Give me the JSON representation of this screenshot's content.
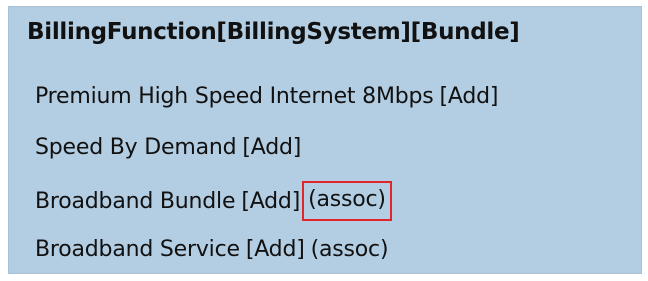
{
  "header": {
    "title": "BillingFunction[BillingSystem][Bundle]"
  },
  "items": [
    {
      "name": "Premium High Speed Internet 8Mbps",
      "action": "[Add]",
      "assoc": null
    },
    {
      "name": "Speed By Demand",
      "action": "[Add]",
      "assoc": null
    },
    {
      "name": "Broadband Bundle",
      "action": "[Add]",
      "assoc": "(assoc)",
      "highlighted": true
    },
    {
      "name": "Broadband Service",
      "action": "[Add]",
      "assoc": "(assoc)"
    }
  ],
  "colors": {
    "panel_background": "#b3cde2",
    "highlight_border": "#e0262b",
    "text": "#111111"
  }
}
